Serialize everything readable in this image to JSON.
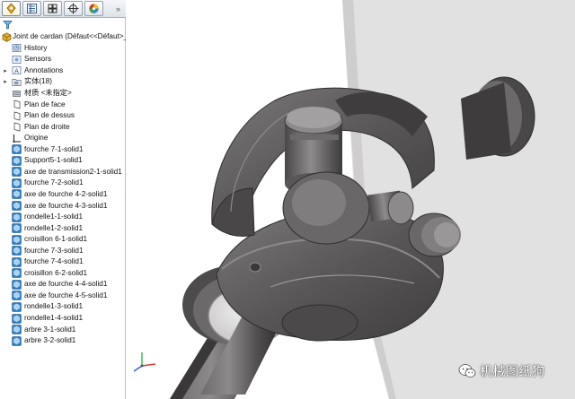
{
  "panel": {
    "tabs": [
      {
        "name": "featuremanager-tab",
        "icon": "feature-tree-icon",
        "active": true
      },
      {
        "name": "propertymanager-tab",
        "icon": "property-list-icon",
        "active": false
      },
      {
        "name": "configurationmanager-tab",
        "icon": "configuration-icon",
        "active": false
      },
      {
        "name": "dimxpert-tab",
        "icon": "crosshair-icon",
        "active": false
      },
      {
        "name": "display-manager-tab",
        "icon": "color-wheel-icon",
        "active": false
      }
    ],
    "expand_glyph": "»",
    "root": {
      "label": "Joint de cardan  (Défaut<<Défaut>_Et",
      "icon": "part-icon"
    },
    "items": [
      {
        "label": "History",
        "icon": "history-icon",
        "expander": ""
      },
      {
        "label": "Sensors",
        "icon": "sensor-icon",
        "expander": ""
      },
      {
        "label": "Annotations",
        "icon": "annotations-icon",
        "expander": "▸"
      },
      {
        "label": "实体(18)",
        "icon": "solid-bodies-folder-icon",
        "expander": "▸"
      },
      {
        "label": "材质 <未指定>",
        "icon": "material-icon",
        "expander": ""
      },
      {
        "label": "Plan de face",
        "icon": "plane-icon",
        "expander": ""
      },
      {
        "label": "Plan de dessus",
        "icon": "plane-icon",
        "expander": ""
      },
      {
        "label": "Plan de droite",
        "icon": "plane-icon",
        "expander": ""
      },
      {
        "label": "Origine",
        "icon": "origin-icon",
        "expander": ""
      },
      {
        "label": "fourche 7-1-solid1",
        "icon": "imported-body-icon",
        "expander": ""
      },
      {
        "label": "Support5-1-solid1",
        "icon": "imported-body-icon",
        "expander": ""
      },
      {
        "label": "axe de transmission2-1-solid1",
        "icon": "imported-body-icon",
        "expander": ""
      },
      {
        "label": "fourche 7-2-solid1",
        "icon": "imported-body-icon",
        "expander": ""
      },
      {
        "label": "axe de fourche 4-2-solid1",
        "icon": "imported-body-icon",
        "expander": ""
      },
      {
        "label": "axe de fourche 4-3-solid1",
        "icon": "imported-body-icon",
        "expander": ""
      },
      {
        "label": "rondelle1-1-solid1",
        "icon": "imported-body-icon",
        "expander": ""
      },
      {
        "label": "rondelle1-2-solid1",
        "icon": "imported-body-icon",
        "expander": ""
      },
      {
        "label": "croisillon 6-1-solid1",
        "icon": "imported-body-icon",
        "expander": ""
      },
      {
        "label": "fourche 7-3-solid1",
        "icon": "imported-body-icon",
        "expander": ""
      },
      {
        "label": "fourche 7-4-solid1",
        "icon": "imported-body-icon",
        "expander": ""
      },
      {
        "label": "croisillon 6-2-solid1",
        "icon": "imported-body-icon",
        "expander": ""
      },
      {
        "label": "axe de fourche 4-4-solid1",
        "icon": "imported-body-icon",
        "expander": ""
      },
      {
        "label": "axe de fourche 4-5-solid1",
        "icon": "imported-body-icon",
        "expander": ""
      },
      {
        "label": "rondelle1-3-solid1",
        "icon": "imported-body-icon",
        "expander": ""
      },
      {
        "label": "rondelle1-4-solid1",
        "icon": "imported-body-icon",
        "expander": ""
      },
      {
        "label": "arbre 3-1-solid1",
        "icon": "imported-body-icon",
        "expander": ""
      },
      {
        "label": "arbre 3-2-solid1",
        "icon": "imported-body-icon",
        "expander": ""
      }
    ],
    "filter_icon": "filter-funnel-icon",
    "splitter_glyph": "◂"
  },
  "viewport": {
    "model": "universal-joint-model",
    "triad_icon": "axis-triad-icon",
    "colors": {
      "metal": "#5a5758",
      "metal_dark": "#3b3939",
      "metal_light": "#8d8a8b",
      "background_plate": "#e2e1e1"
    }
  },
  "watermark": {
    "text": "机械图纸狗",
    "icon": "wechat-icon"
  }
}
